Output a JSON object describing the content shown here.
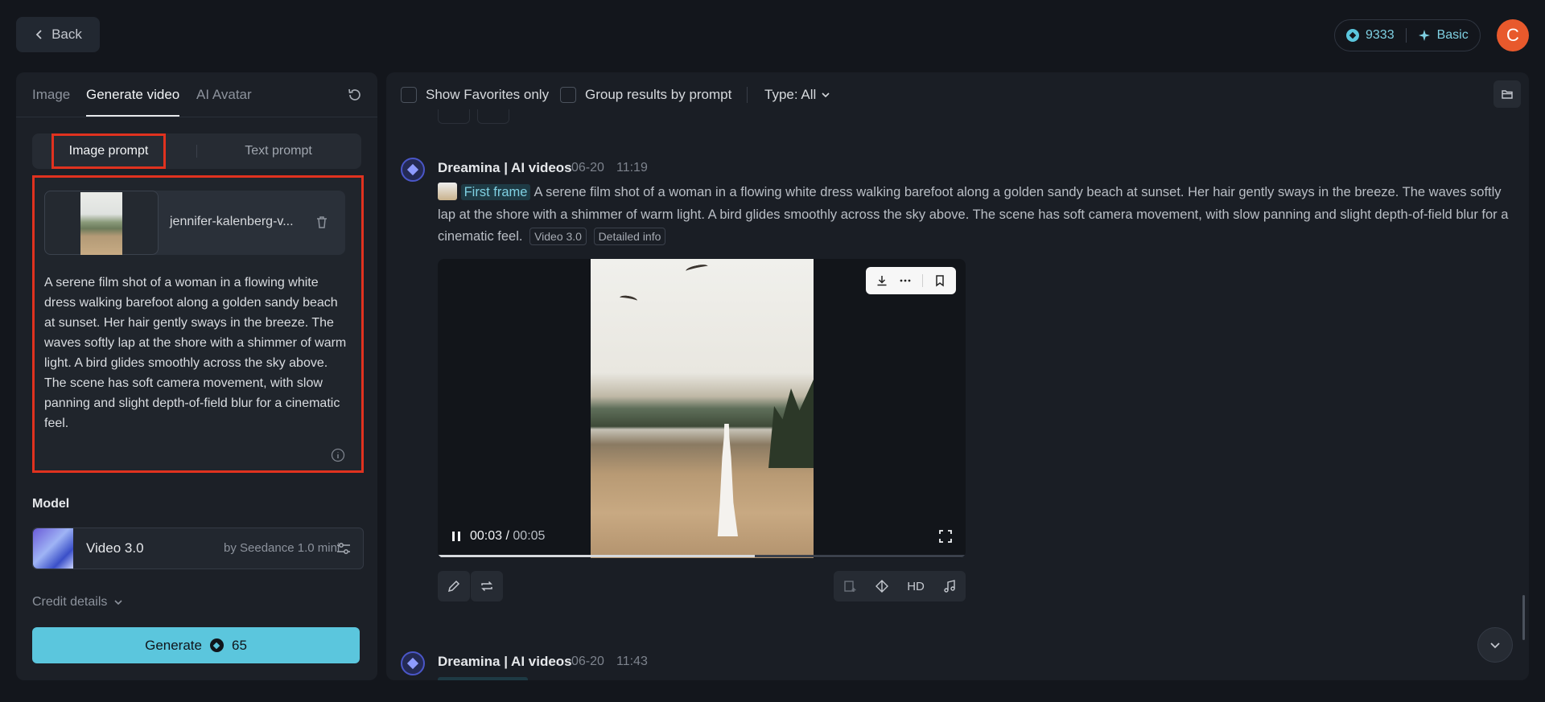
{
  "topbar": {
    "back_label": "Back",
    "credits": "9333",
    "plan": "Basic",
    "avatar_letter": "C"
  },
  "left": {
    "tabs": [
      {
        "label": "Image",
        "active": false
      },
      {
        "label": "Generate video",
        "active": true
      },
      {
        "label": "AI Avatar",
        "active": false
      }
    ],
    "prompt_modes": [
      {
        "label": "Image prompt",
        "active": true
      },
      {
        "label": "Text prompt",
        "active": false
      }
    ],
    "file_name": "jennifer-kalenberg-v...",
    "prompt_text": "A serene film shot of a woman in a flowing white dress walking barefoot along a golden sandy beach at sunset. Her hair gently sways in the breeze. The waves softly lap at the shore with a shimmer of warm light. A bird glides smoothly across the sky above. The scene has soft camera movement, with slow panning and slight depth-of-field blur for a cinematic feel.",
    "model_label": "Model",
    "model_name": "Video 3.0",
    "model_by": "by Seedance 1.0 mini",
    "credit_details": "Credit details",
    "generate_label": "Generate",
    "generate_cost": "65"
  },
  "right": {
    "filters": {
      "favorites": "Show Favorites only",
      "group": "Group results by prompt",
      "type": "Type: All"
    },
    "messages": [
      {
        "author": "Dreamina | AI videos",
        "date": "06-20",
        "time": "11:19",
        "first_frame": "First frame",
        "prompt": "A serene film shot of a woman in a flowing white dress walking barefoot along a golden sandy beach at sunset. Her hair gently sways in the breeze. The waves softly lap at the shore with a shimmer of warm light. A bird glides smoothly across the sky above. The scene has soft camera movement, with slow panning and slight depth-of-field blur for a cinematic feel.",
        "chip_model": "Video 3.0",
        "chip_info": "Detailed info",
        "video": {
          "current_time": "00:03",
          "duration": "00:05",
          "progress": 0.6
        },
        "hd_label": "HD"
      },
      {
        "author": "Dreamina | AI videos",
        "date": "06-20",
        "time": "11:43"
      }
    ]
  },
  "colors": {
    "accent": "#5bc6dd",
    "highlight_border": "#e0321f",
    "avatar_bg": "#e8592c"
  }
}
